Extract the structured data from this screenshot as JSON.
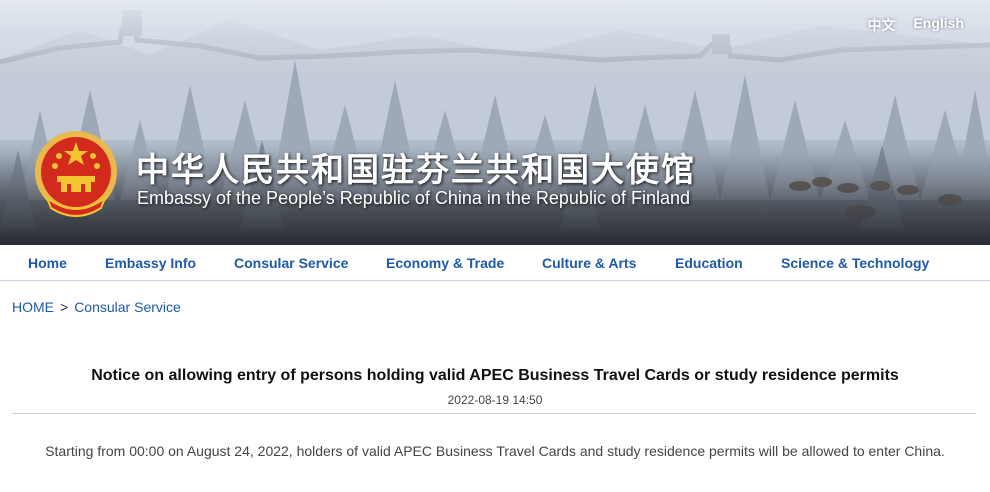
{
  "header": {
    "lang_links": [
      "中文",
      "English"
    ],
    "title_cn": "中华人民共和国驻芬兰共和国大使馆",
    "title_en": "Embassy of the People’s Republic of China in the Republic of Finland",
    "emblem_icon": "national-emblem-icon"
  },
  "nav": {
    "items": [
      "Home",
      "Embassy Info",
      "Consular Service",
      "Economy & Trade",
      "Culture & Arts",
      "Education",
      "Science & Technology"
    ]
  },
  "breadcrumb": {
    "home": "HOME",
    "separator": ">",
    "current": "Consular Service"
  },
  "article": {
    "title": "Notice on allowing entry of persons holding valid APEC Business Travel Cards or study residence permits",
    "date": "2022-08-19 14:50",
    "body": "Starting from 00:00 on August 24, 2022, holders of valid APEC Business Travel Cards and study residence permits will be allowed to enter China."
  },
  "colors": {
    "nav_link": "#1f5aa6",
    "emblem_red": "#d32a1e",
    "emblem_gold": "#f4c430"
  }
}
